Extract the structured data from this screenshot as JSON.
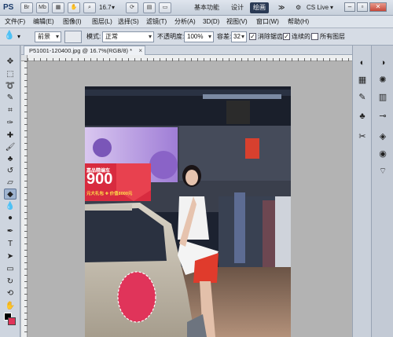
{
  "titlebar": {
    "logo": "PS",
    "br_label": "Br",
    "mb_label": "Mb",
    "zoom": "16.7",
    "workspaces": [
      "基本功能",
      "设计",
      "绘画"
    ],
    "active_workspace": "绘画",
    "more": "≫",
    "cs_live": "CS Live"
  },
  "menu": {
    "items": [
      "文件(F)",
      "编辑(E)",
      "图像(I)",
      "图层(L)",
      "选择(S)",
      "滤镜(T)",
      "分析(A)",
      "3D(D)",
      "视图(V)",
      "窗口(W)",
      "帮助(H)"
    ]
  },
  "options": {
    "fill_source": "前景",
    "mode_label": "模式:",
    "mode_value": "正常",
    "opacity_label": "不透明度:",
    "opacity_value": "100%",
    "tolerance_label": "容差:",
    "tolerance_value": "32",
    "antialias_label": "消除锯齿",
    "contiguous_label": "连续的",
    "all_layers_label": "所有图层",
    "antialias_checked": true,
    "contiguous_checked": true,
    "all_layers_checked": false
  },
  "document": {
    "tab_title": "P51001-120400.jpg @ 16.7%(RGB/8) *",
    "close": "×"
  },
  "colors": {
    "foreground": "#000000",
    "background": "#e0345a",
    "selection_fill": "#e0345a",
    "active_workspace_bg": "#2a3a55"
  },
  "photo_text": {
    "banner_sub": "嘉品精编车",
    "banner_price": "900",
    "banner_small": "元大礼包 ✚ 价值8000元"
  },
  "icons": {
    "tools": [
      "move-icon",
      "marquee-icon",
      "lasso-icon",
      "quick-select-icon",
      "crop-icon",
      "eyedropper-icon",
      "healing-icon",
      "brush-icon",
      "clone-stamp-icon",
      "history-brush-icon",
      "eraser-icon",
      "paint-bucket-icon",
      "blur-icon",
      "dodge-icon",
      "pen-icon",
      "type-icon",
      "path-select-icon",
      "shape-icon",
      "3d-rotate-icon",
      "3d-orbit-icon",
      "hand-icon",
      "zoom-icon"
    ],
    "dock": [
      "color-panel-icon",
      "swatches-icon",
      "brush-panel-icon",
      "clone-source-icon",
      "adjustments-icon",
      "masks-icon",
      "tools-panel-icon",
      "layers-icon",
      "channels-icon",
      "paths-icon"
    ]
  }
}
